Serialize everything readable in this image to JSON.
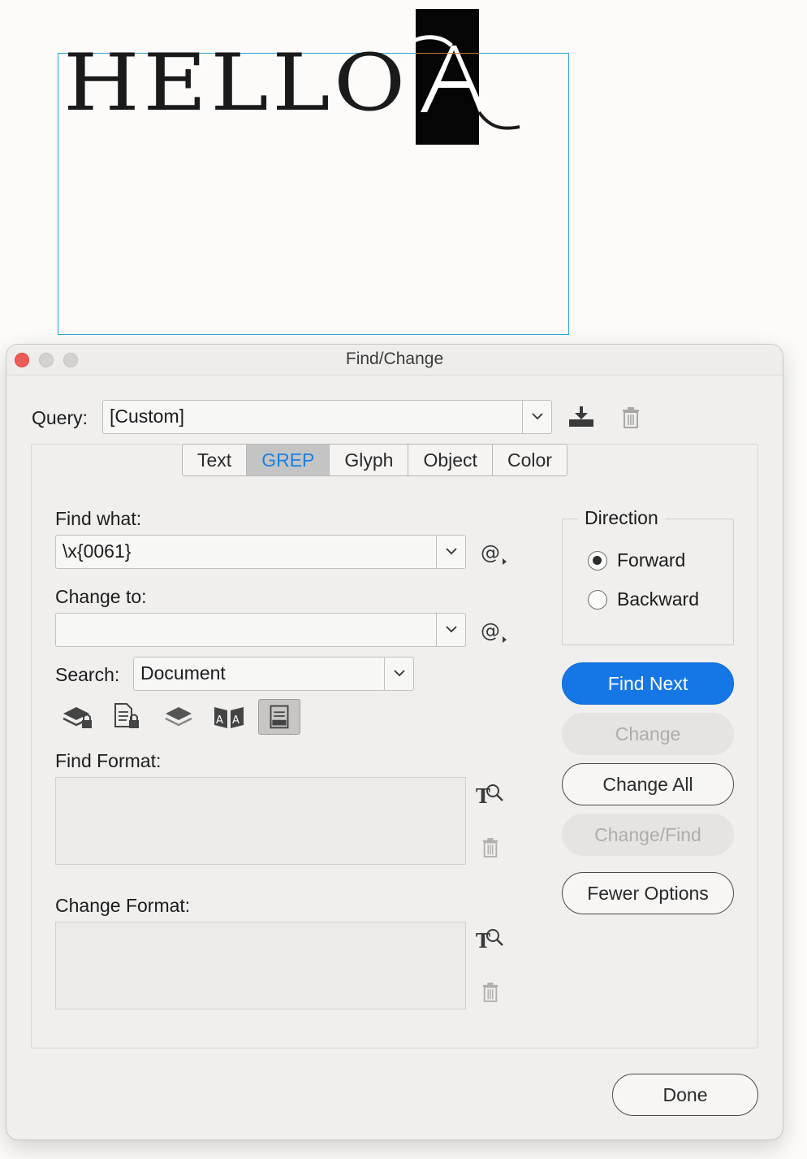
{
  "canvas": {
    "hello_text": "HELLO",
    "selected_glyph": "A"
  },
  "dialog": {
    "title": "Find/Change",
    "query": {
      "label": "Query:",
      "value": "[Custom]"
    },
    "tabs": [
      {
        "label": "Text",
        "active": false
      },
      {
        "label": "GREP",
        "active": true
      },
      {
        "label": "Glyph",
        "active": false
      },
      {
        "label": "Object",
        "active": false
      },
      {
        "label": "Color",
        "active": false
      }
    ],
    "find_what": {
      "label": "Find what:",
      "value": "\\x{0061}"
    },
    "change_to": {
      "label": "Change to:",
      "value": ""
    },
    "search": {
      "label": "Search:",
      "value": "Document"
    },
    "direction": {
      "legend": "Direction",
      "options": [
        {
          "label": "Forward",
          "checked": true
        },
        {
          "label": "Backward",
          "checked": false
        }
      ]
    },
    "buttons": {
      "find_next": "Find Next",
      "change": "Change",
      "change_all": "Change All",
      "change_find": "Change/Find",
      "fewer_options": "Fewer Options",
      "done": "Done"
    },
    "find_format": {
      "label": "Find Format:"
    },
    "change_format": {
      "label": "Change Format:"
    },
    "search_options": [
      "include-locked-layers-icon",
      "include-locked-stories-icon",
      "include-hidden-layers-icon",
      "include-master-pages-icon",
      "include-footnotes-icon"
    ],
    "colors": {
      "accent": "#1577e6",
      "active_tab_text": "#1a7fe0",
      "close_button": "#ee5b54"
    }
  }
}
